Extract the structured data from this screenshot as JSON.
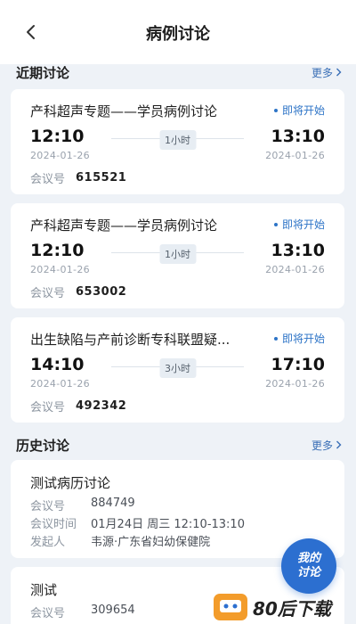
{
  "header": {
    "title": "病例讨论",
    "back_icon": "chevron-left-icon"
  },
  "recent": {
    "section_title": "近期讨论",
    "more_label": "更多",
    "items": [
      {
        "title": "产科超声专题——学员病例讨论",
        "status": "即将开始",
        "start_time": "12:10",
        "end_time": "13:10",
        "start_date": "2024-01-26",
        "end_date": "2024-01-26",
        "duration": "1小时",
        "meeting_label": "会议号",
        "meeting_no": "615521"
      },
      {
        "title": "产科超声专题——学员病例讨论",
        "status": "即将开始",
        "start_time": "12:10",
        "end_time": "13:10",
        "start_date": "2024-01-26",
        "end_date": "2024-01-26",
        "duration": "1小时",
        "meeting_label": "会议号",
        "meeting_no": "653002"
      },
      {
        "title": "出生缺陷与产前诊断专科联盟疑...",
        "status": "即将开始",
        "start_time": "14:10",
        "end_time": "17:10",
        "start_date": "2024-01-26",
        "end_date": "2024-01-26",
        "duration": "3小时",
        "meeting_label": "会议号",
        "meeting_no": "492342"
      }
    ]
  },
  "history": {
    "section_title": "历史讨论",
    "more_label": "更多",
    "items": [
      {
        "title": "测试病历讨论",
        "meeting_label": "会议号",
        "meeting_no": "884749",
        "time_label": "会议时间",
        "time_value": "01月24日 周三 12:10-13:10",
        "initiator_label": "发起人",
        "initiator_value": "韦源·广东省妇幼保健院"
      },
      {
        "title": "测试",
        "meeting_label": "会议号",
        "meeting_no": "309654"
      }
    ]
  },
  "fab": {
    "line1": "我的",
    "line2": "讨论"
  },
  "watermark": {
    "text": "80后下载"
  },
  "colors": {
    "accent": "#2d74c7",
    "background": "#eef2f7",
    "fab": "#2c6fd0"
  }
}
